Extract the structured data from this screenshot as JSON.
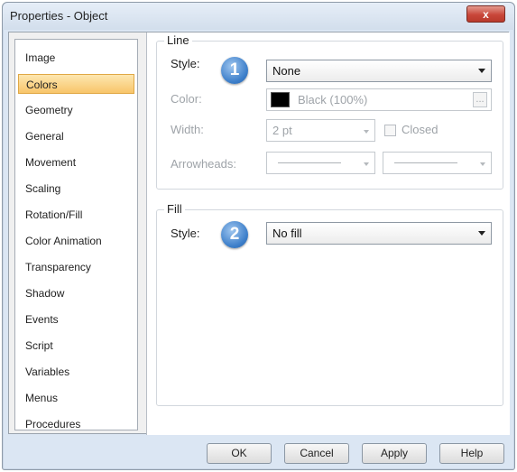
{
  "window": {
    "title": "Properties - Object",
    "close_label": "x"
  },
  "nav": {
    "items": [
      {
        "label": "Image"
      },
      {
        "label": "Colors",
        "selected": true
      },
      {
        "label": "Geometry"
      },
      {
        "label": "General"
      },
      {
        "label": "Movement"
      },
      {
        "label": "Scaling"
      },
      {
        "label": "Rotation/Fill"
      },
      {
        "label": "Color Animation"
      },
      {
        "label": "Transparency"
      },
      {
        "label": "Shadow"
      },
      {
        "label": "Events"
      },
      {
        "label": "Script"
      },
      {
        "label": "Variables"
      },
      {
        "label": "Menus"
      },
      {
        "label": "Procedures"
      }
    ]
  },
  "line_group": {
    "title": "Line",
    "style_label": "Style:",
    "style_badge": "1",
    "style_value": "None",
    "color_label": "Color:",
    "color_value": "Black (100%)",
    "color_swatch": "#000000",
    "color_button": "...",
    "width_label": "Width:",
    "width_value": "2 pt",
    "closed_label": "Closed",
    "closed_checked": false,
    "arrowheads_label": "Arrowheads:"
  },
  "fill_group": {
    "title": "Fill",
    "style_label": "Style:",
    "style_badge": "2",
    "style_value": "No fill"
  },
  "footer": {
    "ok_label": "OK",
    "cancel_label": "Cancel",
    "apply_label": "Apply",
    "help_label": "Help"
  },
  "colors": {
    "selection": "#f8c56a",
    "badge": "#3d7fca",
    "close_button": "#c9473a"
  }
}
